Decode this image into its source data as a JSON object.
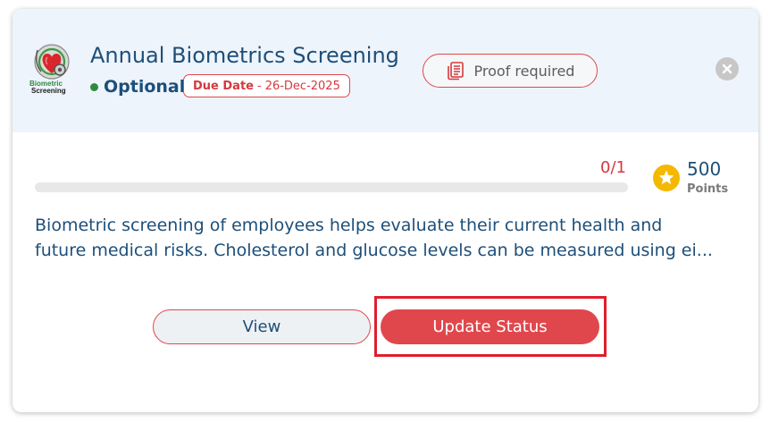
{
  "card": {
    "title": "Annual Biometrics Screening",
    "logo": {
      "icon": "biometric-screening-logo",
      "text_line1": "Biometric",
      "text_line2": "Screening"
    },
    "optional_label": "Optional",
    "due": {
      "label": "Due Date",
      "separator": "-",
      "value": "26-Dec-2025"
    },
    "proof": {
      "icon": "document-icon",
      "label": "Proof required"
    },
    "close_icon": "close-icon",
    "progress": {
      "label": "0/1",
      "completed": 0,
      "total": 1
    },
    "points": {
      "icon": "star-icon",
      "value": "500",
      "label": "Points"
    },
    "description": "Biometric screening of employees helps evaluate their current health and future medical risks. Cholesterol and glucose levels can be measured using ei...",
    "actions": {
      "view_label": "View",
      "update_label": "Update Status"
    }
  },
  "colors": {
    "accent": "#e0474c",
    "title": "#1d4f7a",
    "header_bg": "#eef4fb",
    "optional_dot": "#2e8b3e",
    "star": "#f5b800",
    "highlight": "#e01e2c"
  }
}
